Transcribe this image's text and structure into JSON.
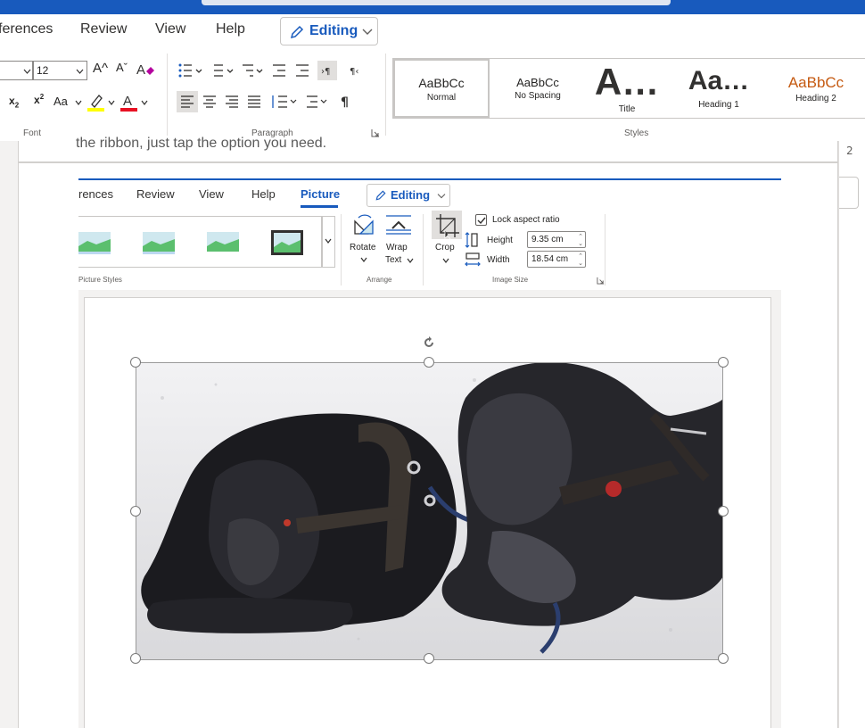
{
  "menu": {
    "items": [
      "ferences",
      "Review",
      "View",
      "Help"
    ],
    "editing": "Editing"
  },
  "ribbon": {
    "font": {
      "size": "12",
      "grow": "A^",
      "shrink": "Aˇ",
      "change_case": "Aa",
      "label": "Font"
    },
    "paragraph": {
      "label": "Paragraph"
    },
    "styles": {
      "label": "Styles",
      "items": [
        {
          "sample": "AaBbCc",
          "name": "Normal"
        },
        {
          "sample": "AaBbCc",
          "name": "No Spacing"
        },
        {
          "sample": "A…",
          "name": "Title"
        },
        {
          "sample": "Aa…",
          "name": "Heading 1"
        },
        {
          "sample": "AaBbCc",
          "name": "Heading 2"
        }
      ]
    }
  },
  "document": {
    "cut_text": "the ribbon, just tap the option you need.",
    "page_number": "2"
  },
  "inner_screenshot": {
    "menu": [
      "rences",
      "Review",
      "View",
      "Help",
      "Picture"
    ],
    "editing": "Editing",
    "picture_styles_label": "Picture Styles",
    "arrange": {
      "rotate": "Rotate",
      "wrap": "Wrap",
      "wrap2": "Text",
      "label": "Arrange"
    },
    "crop": "Crop",
    "image_size": {
      "lock": "Lock aspect ratio",
      "height_label": "Height",
      "height_value": "9.35 cm",
      "width_label": "Width",
      "width_value": "18.54 cm",
      "label": "Image Size"
    }
  },
  "colors": {
    "brand": "#185abd",
    "heading2": "#c55a11"
  }
}
